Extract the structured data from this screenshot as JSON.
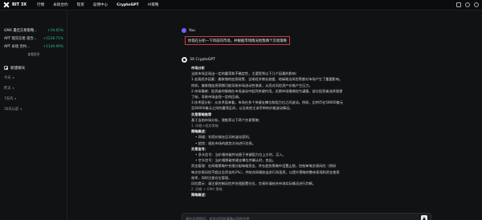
{
  "topbar": {
    "logo_text": "BIT 3X",
    "nav": [
      "行情",
      "永续合约",
      "现货",
      "返佣中心",
      "CryptoGPT",
      "AI策略"
    ],
    "active_index": 4
  },
  "sidebar": {
    "pairs": [
      {
        "name": "GMX 最佳交易策略...",
        "change": "+19.65%"
      },
      {
        "name": "APT 现货交易 适合...",
        "change": "+2228.71%"
      },
      {
        "name": "APT 永续 合约...",
        "change": "+1149.99%"
      }
    ],
    "view_all": "查看更多",
    "new_chat": "新建聊天",
    "history": [
      "今天",
      "昨天",
      "7天内",
      "30天以前"
    ]
  },
  "chat": {
    "user_name": "You",
    "user_message": "你现在分析一下目前的市场，并根据市场情况给我两个交易策略",
    "bot_name": "3X CryptoGPT",
    "lines": [
      {
        "t": "市场分析",
        "c": "h"
      },
      {
        "t": "当前市场呈现出一定的震荡和不确定性，主要受到以下几个因素的影响：",
        "c": ""
      },
      {
        "t": "1.宏观经济因素：美联储的加息政策、全球经济增长放缓、地缘政治风险等都对市场产生了重要影响。",
        "c": ""
      },
      {
        "t": "例如，美联储加息预期可能导致市场流动性收紧，从而对风险资产价格产生压力。",
        "c": ""
      },
      {
        "t": "2.市场情绪：投资者的情绪在市场波动中起到关键作用。近期市场情绪较为谨慎，部分投资者选择观望",
        "c": ""
      },
      {
        "t": "了结，导致市场出现一定的回调。",
        "c": ""
      },
      {
        "t": "3.技术面分析：从技术面来看，市场在多个关键支撑位和阻力位之间波动。例如，比特币在58000美元",
        "c": ""
      },
      {
        "t": "至60000美元之间的震荡区间，以及其他主流币种的价格波动情况。",
        "c": ""
      },
      {
        "t": "交易策略推荐",
        "c": "h"
      },
      {
        "t": "基于当前市场分析，我推荐以下两个交易策略：",
        "c": ""
      },
      {
        "t": "1. 网格+趋势策略",
        "c": "sub"
      },
      {
        "t": "策略概述：",
        "c": "h"
      },
      {
        "t": "• 网格：利用价格在区间的波动获利。",
        "c": "ind"
      },
      {
        "t": "• 趋势：顺应市场的趋势方向进行交易。",
        "c": "ind"
      },
      {
        "t": "交易信号：",
        "c": "h"
      },
      {
        "t": "• 多头信号：当价格突破并站稳于关键阻力位上方时，买入。",
        "c": "ind"
      },
      {
        "t": "• 空头信号：当价格跌破关键支撑位并确认时，卖出。",
        "c": "ind"
      },
      {
        "t": "资金管理：在网格策略中合理分配每格资金，并在趋势策略中设置止损，控制单笔交易风险（例如",
        "c": ""
      },
      {
        "t": "每次交易风险不超过总资金的2%），并结合网格收益进行再投资，以提升策略的整体表现和资金使用",
        "c": ""
      },
      {
        "t": "效率，同时注意仓位管理。",
        "c": ""
      },
      {
        "t": "风险提示：请注意控制风险并合理配置仓位，交易时请结合市场实际情况进行判断。",
        "c": ""
      },
      {
        "t": "2. 网格 + EMA 策略",
        "c": "sub"
      },
      {
        "t": "策略概述：",
        "c": "h"
      }
    ],
    "input_placeholder": "请在这里提问，发送对话前请确认您的信息"
  }
}
